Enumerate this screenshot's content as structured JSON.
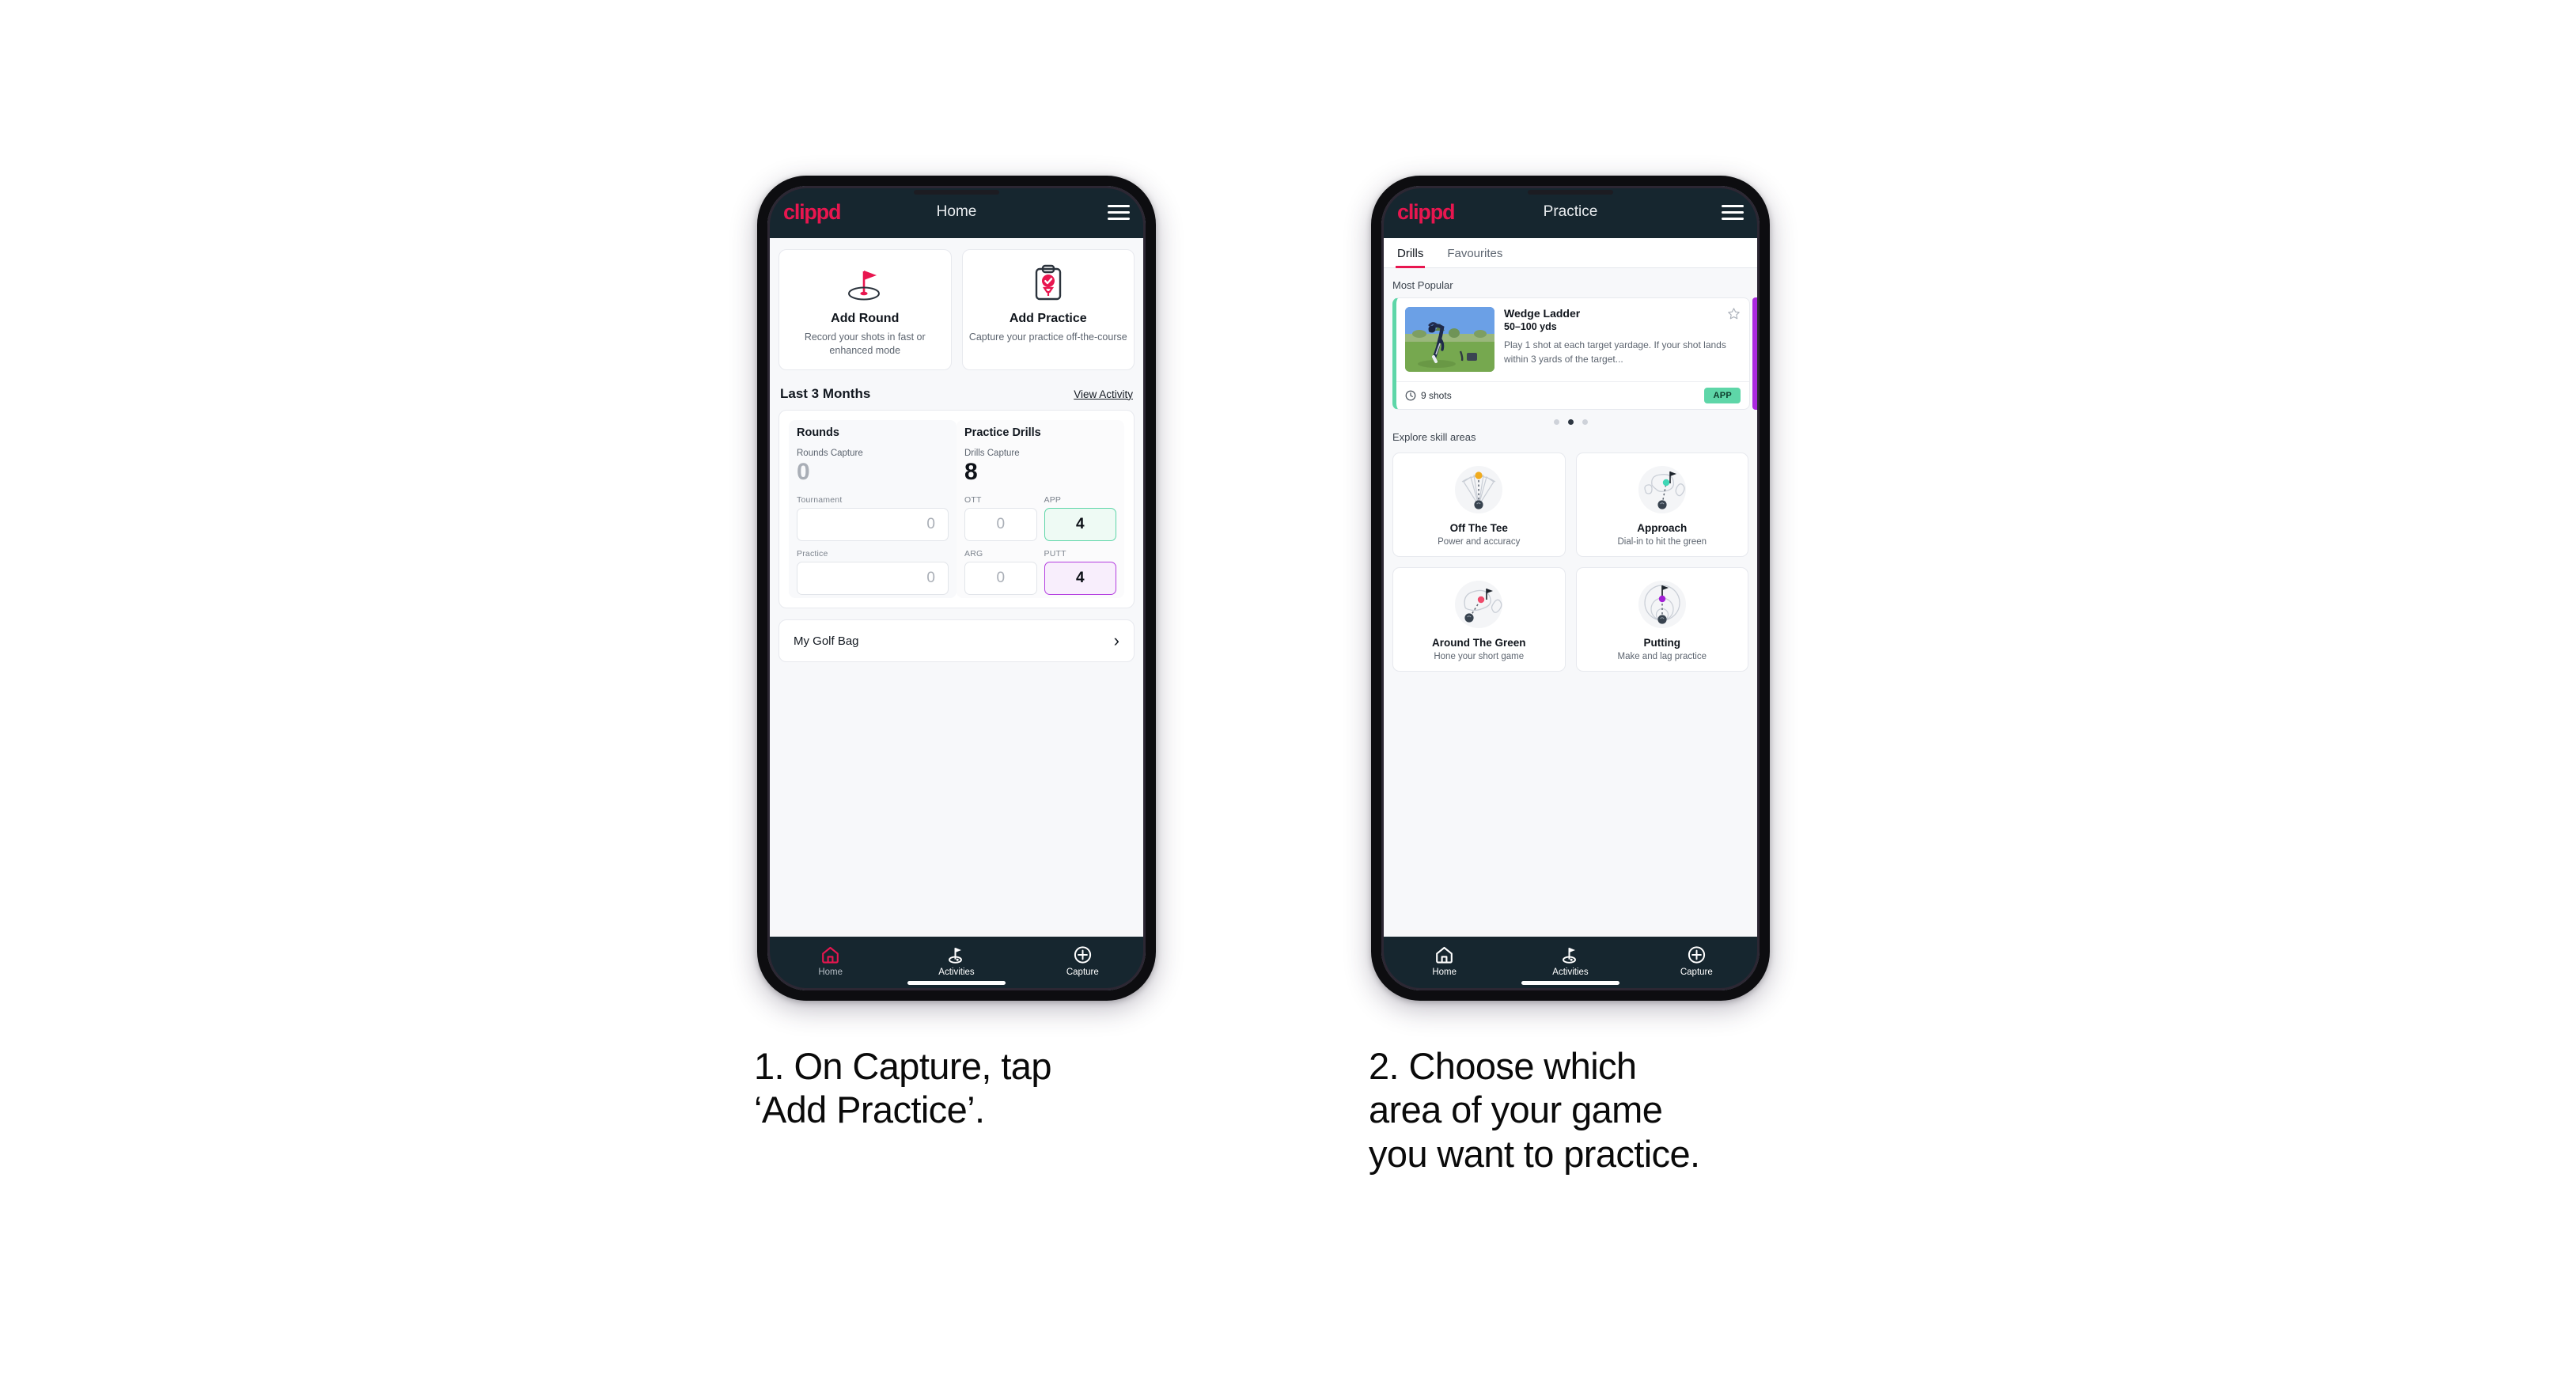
{
  "brand": "clippd",
  "phone1": {
    "appbar": {
      "title": "Home",
      "menu_icon": "hamburger-icon"
    },
    "quick_actions": [
      {
        "icon": "golf-flag-hole-icon",
        "title": "Add Round",
        "subtitle": "Record your shots in fast or enhanced mode"
      },
      {
        "icon": "clipboard-check-tee-icon",
        "title": "Add Practice",
        "subtitle": "Capture your practice off-the-course"
      }
    ],
    "section": {
      "title": "Last 3 Months",
      "link": "View Activity"
    },
    "rounds": {
      "title": "Rounds",
      "capture_label": "Rounds Capture",
      "capture_value": "0",
      "fields": [
        {
          "label": "Tournament",
          "value": "0",
          "highlight": "none"
        },
        {
          "label": "Practice",
          "value": "0",
          "highlight": "none"
        }
      ]
    },
    "drills": {
      "title": "Practice Drills",
      "capture_label": "Drills Capture",
      "capture_value": "8",
      "fields": [
        {
          "label": "OTT",
          "value": "0",
          "highlight": "none"
        },
        {
          "label": "APP",
          "value": "4",
          "highlight": "green"
        },
        {
          "label": "ARG",
          "value": "0",
          "highlight": "none"
        },
        {
          "label": "PUTT",
          "value": "4",
          "highlight": "purple"
        }
      ]
    },
    "golf_bag": {
      "label": "My Golf Bag",
      "icon": "chevron-right-icon"
    },
    "tabbar": [
      {
        "label": "Home",
        "icon": "home-icon",
        "active": true
      },
      {
        "label": "Activities",
        "icon": "golf-flag-icon",
        "active": false
      },
      {
        "label": "Capture",
        "icon": "plus-circle-icon",
        "active": false
      }
    ]
  },
  "phone2": {
    "appbar": {
      "title": "Practice",
      "menu_icon": "hamburger-icon"
    },
    "tabs": [
      {
        "label": "Drills",
        "active": true
      },
      {
        "label": "Favourites",
        "active": false
      }
    ],
    "most_popular_label": "Most Popular",
    "drill": {
      "name": "Wedge Ladder",
      "yardage": "50–100 yds",
      "description": "Play 1 shot at each target yardage. If your shot lands within 3 yards of the target...",
      "shots": "9 shots",
      "shots_icon": "clock-icon",
      "badge": "APP",
      "favourite_icon": "star-outline-icon",
      "accent_color": "#5ed6a8",
      "next_card_accent": "#ab28df"
    },
    "carousel_dots": {
      "count": 3,
      "active_index": 1
    },
    "explore_label": "Explore skill areas",
    "skill_areas": [
      {
        "icon": "off-the-tee-fan-icon",
        "title": "Off The Tee",
        "subtitle": "Power and accuracy",
        "dot_color": "#f0ab1e"
      },
      {
        "icon": "approach-green-icon",
        "title": "Approach",
        "subtitle": "Dial-in to hit the green",
        "dot_color": "#3fd7b6"
      },
      {
        "icon": "around-the-green-icon",
        "title": "Around The Green",
        "subtitle": "Hone your short game",
        "dot_color": "#ef4a6b"
      },
      {
        "icon": "putting-rings-icon",
        "title": "Putting",
        "subtitle": "Make and lag practice",
        "dot_color": "#a21fd6"
      }
    ],
    "tabbar": [
      {
        "label": "Home",
        "icon": "home-icon",
        "active": false
      },
      {
        "label": "Activities",
        "icon": "golf-flag-icon",
        "active": true
      },
      {
        "label": "Capture",
        "icon": "plus-circle-icon",
        "active": false
      }
    ]
  },
  "captions": {
    "step1": "1. On Capture, tap\n‘Add Practice’.",
    "step2": "2. Choose which\narea of your game\nyou want to practice."
  },
  "colors": {
    "brand_pink": "#e8164f",
    "navy": "#16262f",
    "green_accent": "#5ed6a8",
    "purple_accent": "#ab28df",
    "page_bg": "#ffffff"
  }
}
